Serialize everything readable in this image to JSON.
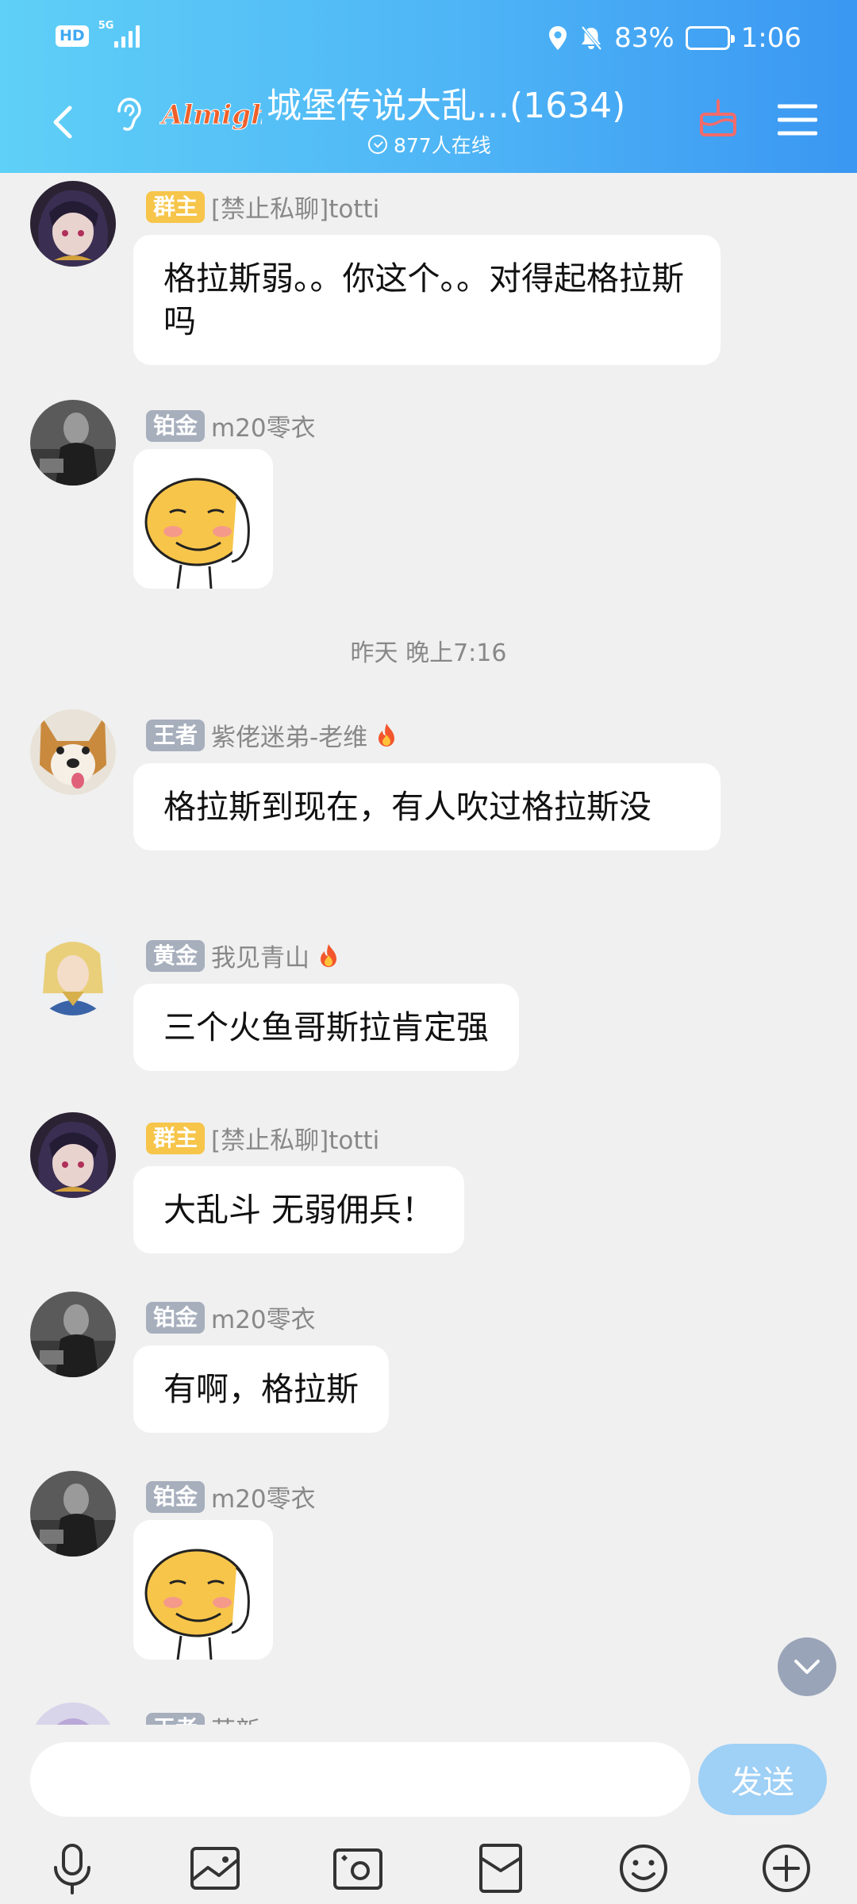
{
  "status_bar": {
    "hd": "HD",
    "network": "5G",
    "battery_percent": "83%",
    "battery_level": 0.83,
    "time": "1:06"
  },
  "header": {
    "group_title": "城堡传说大乱...(1634)",
    "logo_text": "Almighty",
    "online_text": "877人在线"
  },
  "messages": [
    {
      "badge": "群主",
      "name": "[禁止私聊]totti",
      "text": "格拉斯弱。。你这个。。对得起格拉斯吗"
    },
    {
      "badge": "铂金",
      "name": "m20零衣",
      "sticker": "smirk-sticker"
    },
    {
      "time_separator": "昨天 晚上7:16"
    },
    {
      "badge": "王者",
      "name": "紫佬迷弟-老维",
      "text": "格拉斯到现在，有人吹过格拉斯没"
    },
    {
      "badge": "黄金",
      "name": "我见青山",
      "text": "三个火鱼哥斯拉肯定强"
    },
    {
      "badge": "群主",
      "name": "[禁止私聊]totti",
      "text": "大乱斗 无弱佣兵！"
    },
    {
      "badge": "铂金",
      "name": "m20零衣",
      "text": "有啊，格拉斯"
    },
    {
      "badge": "铂金",
      "name": "m20零衣",
      "sticker": "smirk-sticker"
    },
    {
      "badge": "王者",
      "name": "萌新"
    }
  ],
  "input": {
    "placeholder": "",
    "send_label": "发送"
  },
  "colors": {
    "header_gradient_start": "#5fd0f7",
    "header_gradient_end": "#3a97f2",
    "badge_owner": "#f6c54a",
    "badge_rank": "#a7afbd",
    "send_button": "#9fd0f6"
  }
}
